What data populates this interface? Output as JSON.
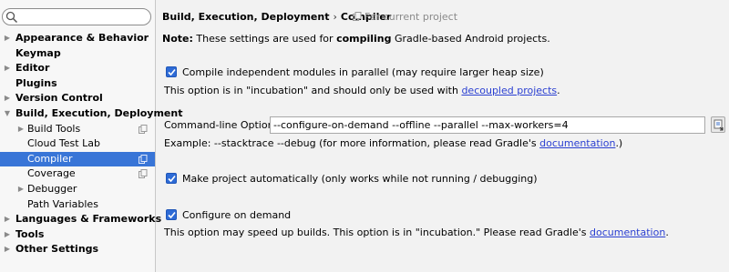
{
  "sidebar": {
    "items": [
      {
        "label": "Appearance & Behavior",
        "bold": true,
        "arrow": "▶"
      },
      {
        "label": "Keymap",
        "bold": true
      },
      {
        "label": "Editor",
        "bold": true,
        "arrow": "▶"
      },
      {
        "label": "Plugins",
        "bold": true
      },
      {
        "label": "Version Control",
        "bold": true,
        "arrow": "▶"
      },
      {
        "label": "Build, Execution, Deployment",
        "bold": true,
        "arrow": "▼"
      },
      {
        "label": "Build Tools",
        "bold": false,
        "arrow": "▶",
        "copy": true
      },
      {
        "label": "Cloud Test Lab",
        "bold": false
      },
      {
        "label": "Compiler",
        "bold": false,
        "copy": true,
        "selected": true
      },
      {
        "label": "Coverage",
        "bold": false,
        "copy": true
      },
      {
        "label": "Debugger",
        "bold": false,
        "arrow": "▶"
      },
      {
        "label": "Path Variables",
        "bold": false
      },
      {
        "label": "Languages & Frameworks",
        "bold": true,
        "arrow": "▶"
      },
      {
        "label": "Tools",
        "bold": true,
        "arrow": "▶"
      },
      {
        "label": "Other Settings",
        "bold": true,
        "arrow": "▶"
      }
    ]
  },
  "header": {
    "parent": "Build, Execution, Deployment",
    "separator": "›",
    "current": "Compiler",
    "scope": "For current project"
  },
  "note": {
    "prefix": "Note:",
    "part1": " These settings are used for ",
    "bold_word": "compiling",
    "part2": " Gradle-based Android projects."
  },
  "options": {
    "parallel": {
      "label": "Compile independent modules in parallel (may require heap size)",
      "label_full": "Compile independent modules in parallel (may require larger heap size)",
      "checked": true,
      "hint_prefix": "This option is in \"incubation\" and should only be used with ",
      "hint_link": "decoupled projects",
      "hint_suffix": "."
    },
    "cmdline": {
      "label": "Command-line Options:",
      "value": "--configure-on-demand --offline --parallel --max-workers=4",
      "example_prefix": "Example: --stacktrace --debug (for more information, please read Gradle's ",
      "example_link": "documentation",
      "example_suffix": ".)"
    },
    "auto_make": {
      "label": "Make project automatically (only works while not running / debugging)",
      "checked": true
    },
    "on_demand": {
      "label": "Configure on demand",
      "checked": true,
      "hint_prefix": "This option may speed up builds. This option is in \"incubation.\" Please read Gradle's ",
      "hint_link": "documentation",
      "hint_suffix": "."
    }
  },
  "colors": {
    "selection": "#3875d7",
    "checkbox": "#2e6bd6",
    "link": "#2a3fd1"
  }
}
